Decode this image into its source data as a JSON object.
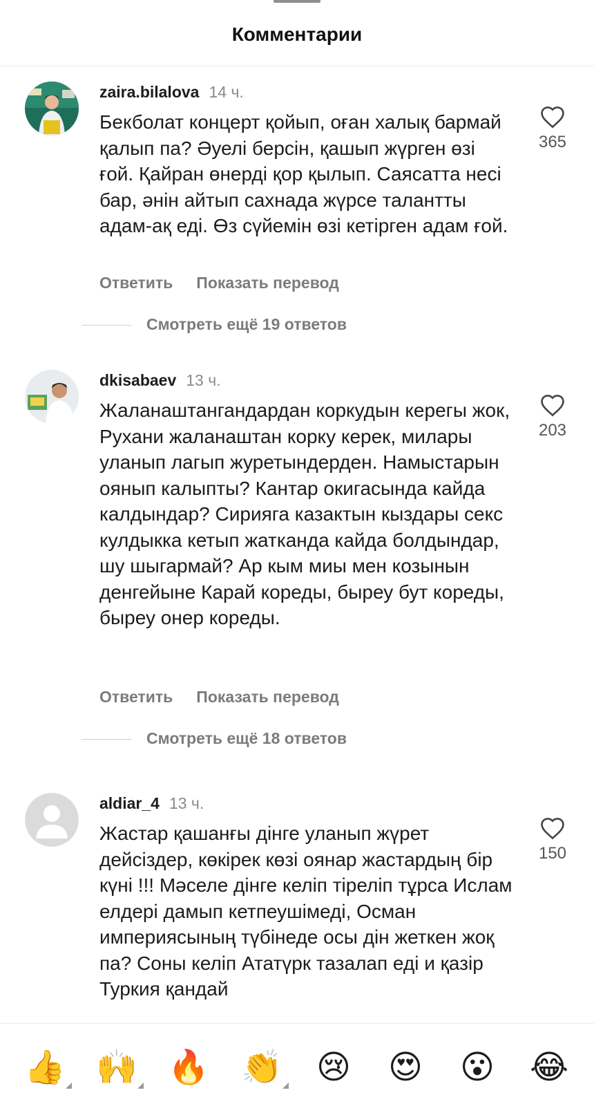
{
  "header": {
    "title": "Комментарии"
  },
  "comments": [
    {
      "username": "zaira.bilalova",
      "time": "14 ч.",
      "text": "Бекболат концерт қойып, оған халық бармай қалып па? Әуелі берсін, қашып жүрген өзі ғой. Қайран өнерді қор қылып. Саясатта несі бар, әнін айтып сахнада жүрсе талантты адам-ақ еді. Өз сүйемін өзі кетірген адам ғой.",
      "likes": "365",
      "reply": "Ответить",
      "translate": "Показать перевод",
      "more_replies": "Смотреть ещё 19 ответов"
    },
    {
      "username": "dkisabaev",
      "time": "13 ч.",
      "text": "Жаланаштангандардан коркудын керегы жок, Рухани жаланаштан корку керек, милары уланып лагып журетындерден. Намыстарын оянып калыпты? Кантар окигасында кайда калдындар? Сирияга казактын кыздары секс кулдыкка кетып жатканда кайда болдындар, шу шыгармай? Ар кым миы мен козынын денгейыне Карай кореды, быреу бут кореды, быреу онер кореды.",
      "likes": "203",
      "reply": "Ответить",
      "translate": "Показать перевод",
      "more_replies": "Смотреть ещё 18 ответов"
    },
    {
      "username": "aldiar_4",
      "time": "13 ч.",
      "text": "Жастар қашанғы дінге уланып жүрет дейсіздер, көкірек көзі оянар жастардың бір күні !!! Мәселе дінге келіп тіреліп тұрса Ислам елдері дамып кетпеушімеді, Осман империясының түбінеде осы дін жеткен жоқ па? Соны келіп Ататүрк тазалап еді и қазір Туркия қандай",
      "likes": "150"
    }
  ],
  "emoji_bar": {
    "items": [
      {
        "icon": "thumbs-up-icon",
        "glyph": "👍"
      },
      {
        "icon": "raising-hands-icon",
        "glyph": "🙌"
      },
      {
        "icon": "fire-icon",
        "glyph": "🔥"
      },
      {
        "icon": "clapping-hands-icon",
        "glyph": "👏"
      },
      {
        "icon": "crying-face-icon",
        "glyph": "😢"
      },
      {
        "icon": "heart-eyes-icon",
        "glyph": "😍"
      },
      {
        "icon": "surprised-face-icon",
        "glyph": "😮"
      },
      {
        "icon": "tears-of-joy-icon",
        "glyph": "😂"
      }
    ]
  }
}
